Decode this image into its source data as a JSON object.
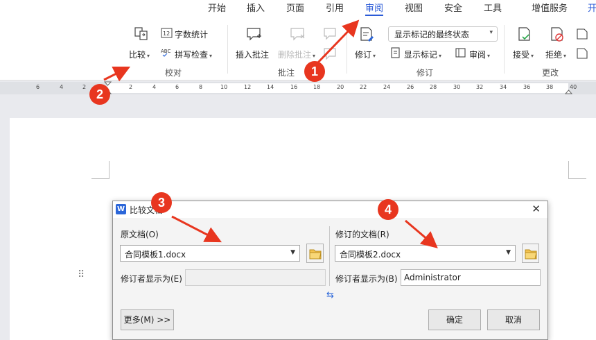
{
  "menu": {
    "tabs": [
      "开始",
      "插入",
      "页面",
      "引用",
      "审阅",
      "视图",
      "安全",
      "工具",
      "增值服务",
      "开"
    ],
    "active": "审阅"
  },
  "ribbon": {
    "groups": {
      "compare": {
        "label": "校对",
        "compare_btn": "比较",
        "word_count_btn": "字数统计",
        "spell_check_btn": "拼写检查"
      },
      "comments": {
        "label": "批注",
        "insert_comment_btn": "插入批注",
        "delete_comment_btn": "删除批注"
      },
      "revision": {
        "label": "修订",
        "track_changes_btn": "修订",
        "markup_select": "显示标记的最终状态",
        "show_markup_btn": "显示标记",
        "review_btn": "审阅"
      },
      "changes": {
        "label": "更改",
        "accept_btn": "接受",
        "reject_btn": "拒绝"
      }
    }
  },
  "ruler": {
    "left_numbers": [
      "6",
      "4",
      "2"
    ],
    "right_numbers": [
      "2",
      "4",
      "6",
      "8",
      "10",
      "12",
      "14",
      "16",
      "18",
      "20",
      "22",
      "24",
      "26",
      "28",
      "30",
      "32",
      "34",
      "36",
      "38",
      "40"
    ]
  },
  "dialog": {
    "title": "比较文档",
    "original": {
      "label": "原文档(O)",
      "file": "合同模板1.docx",
      "reviewer_label": "修订者显示为(E)",
      "reviewer_value": ""
    },
    "revised": {
      "label": "修订的文档(R)",
      "file": "合同模板2.docx",
      "reviewer_label": "修订者显示为(B)",
      "reviewer_value": "Administrator"
    },
    "more_btn": "更多(M) >>",
    "ok_btn": "确定",
    "cancel_btn": "取消"
  },
  "annotations": [
    "1",
    "2",
    "3",
    "4"
  ],
  "colors": {
    "accent": "#2b5bd7",
    "annotation": "#e8361f"
  }
}
